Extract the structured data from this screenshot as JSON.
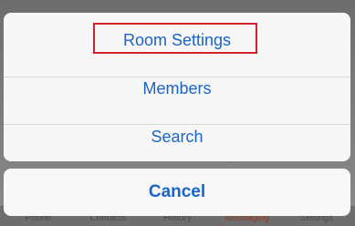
{
  "background_app": {
    "tab_bar": {
      "tabs": [
        {
          "label": "Phone"
        },
        {
          "label": "Contacts"
        },
        {
          "label": "History"
        },
        {
          "label": "Messaging"
        },
        {
          "label": "Settings"
        }
      ],
      "active_tab": "Messaging",
      "colors": {
        "inactive": "#4a4a4a",
        "active": "#8b3b27"
      }
    }
  },
  "action_sheet": {
    "items": [
      {
        "label": "Room Settings",
        "highlighted": true
      },
      {
        "label": "Members"
      },
      {
        "label": "Search"
      }
    ],
    "cancel_label": "Cancel",
    "colors": {
      "text": "#1b64c9",
      "sheet_background": "#f7f7f7",
      "separator": "#d9d9d9",
      "highlight_border": "#d2232a"
    }
  }
}
